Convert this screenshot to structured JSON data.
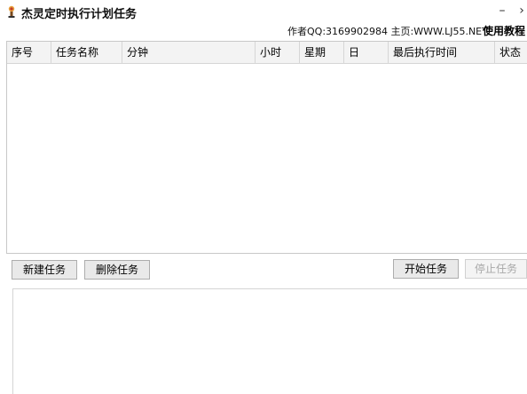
{
  "window": {
    "title": "杰灵定时执行计划任务",
    "min_glyph": "–",
    "close_glyph": "›"
  },
  "header": {
    "author_text": "作者QQ:3169902984 主页:WWW.LJ55.NET",
    "tutorial_link": "使用教程"
  },
  "table": {
    "columns": [
      "序号",
      "任务名称",
      "分钟",
      "小时",
      "星期",
      "日",
      "最后执行时间",
      "状态"
    ],
    "rows": []
  },
  "buttons": {
    "new_task": "新建任务",
    "delete_task": "删除任务",
    "start_task": "开始任务",
    "stop_task": "停止任务"
  },
  "log": {
    "content": ""
  }
}
